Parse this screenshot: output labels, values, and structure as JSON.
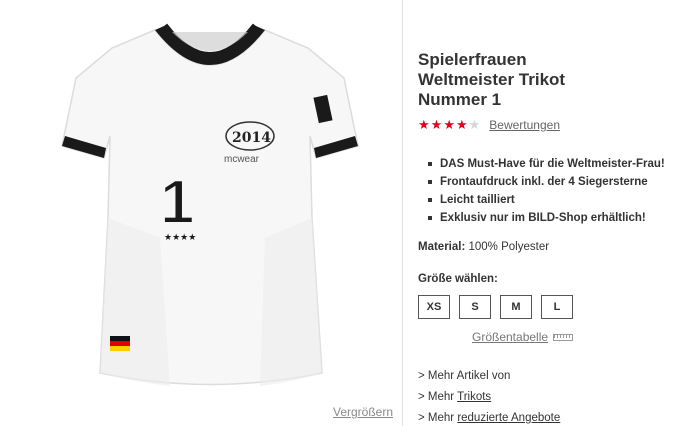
{
  "product": {
    "title_lines": [
      "Spielerfrauen",
      "Weltmeister Trikot",
      "Nummer 1"
    ],
    "rating": {
      "stars_filled": 4,
      "stars_total": 5,
      "reviews_label": "Bewertungen"
    },
    "features": [
      "DAS Must-Have für die Weltmeister-Frau!",
      "Frontaufdruck inkl. der 4 Siegersterne",
      "Leicht tailliert",
      "Exklusiv nur im BILD-Shop erhältlich!"
    ],
    "material_label": "Material:",
    "material_value": "100% Polyester",
    "size_label": "Größe wählen:",
    "sizes": [
      "XS",
      "S",
      "M",
      "L"
    ],
    "size_chart_label": "Größentabelle",
    "more_links": {
      "prefix_1": "> Mehr Artikel von",
      "prefix_2": "> Mehr ",
      "link_2": "Trikots",
      "prefix_3": "> Mehr ",
      "link_3": "reduzierte Angebote"
    },
    "enlarge_label": "Vergrößern"
  },
  "image": {
    "jersey_number": "1",
    "jersey_stars": "★★★★",
    "logo_year": "2014",
    "brand": "mcwear"
  },
  "colors": {
    "accent": "#e3001b",
    "text": "#333333",
    "jersey_trim": "#1a1a1a"
  }
}
